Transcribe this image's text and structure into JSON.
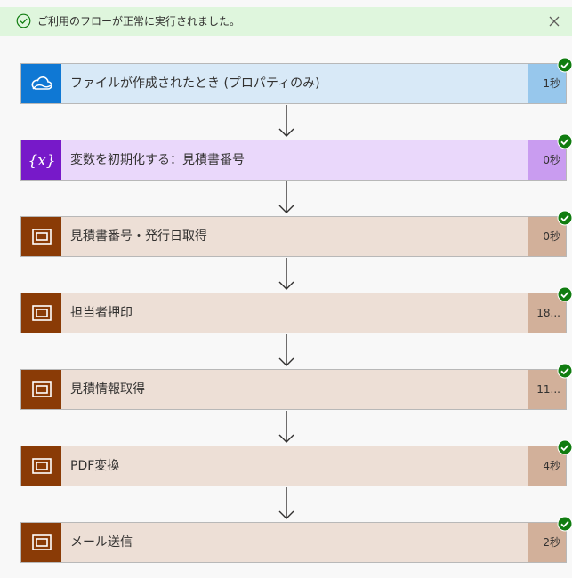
{
  "banner": {
    "message": "ご利用のフローが正常に実行されました。"
  },
  "colors": {
    "banner_bg": "#dff6dd",
    "success_green": "#107c10"
  },
  "steps": [
    {
      "title": "ファイルが作成されたとき (プロパティのみ)",
      "duration": "1秒",
      "icon": "onedrive-cloud-icon",
      "icon_bg": "#0f78d4",
      "body_bg": "#d8e9f7",
      "dur_bg": "#97c7ec",
      "status": "succeeded"
    },
    {
      "title": "変数を初期化する：見積書番号",
      "duration": "0秒",
      "icon": "variable-icon",
      "icon_bg": "#7719c9",
      "body_bg": "#ead8fb",
      "dur_bg": "#c99cf0",
      "status": "succeeded"
    },
    {
      "title": "見積書番号・発行日取得",
      "duration": "0秒",
      "icon": "scope-icon",
      "icon_bg": "#8a3b06",
      "body_bg": "#eddfd6",
      "dur_bg": "#d2b09a",
      "status": "succeeded"
    },
    {
      "title": "担当者押印",
      "duration": "18...",
      "icon": "scope-icon",
      "icon_bg": "#8a3b06",
      "body_bg": "#eddfd6",
      "dur_bg": "#d2b09a",
      "status": "succeeded"
    },
    {
      "title": "見積情報取得",
      "duration": "11...",
      "icon": "scope-icon",
      "icon_bg": "#8a3b06",
      "body_bg": "#eddfd6",
      "dur_bg": "#d2b09a",
      "status": "succeeded"
    },
    {
      "title": "PDF変換",
      "duration": "4秒",
      "icon": "scope-icon",
      "icon_bg": "#8a3b06",
      "body_bg": "#eddfd6",
      "dur_bg": "#d2b09a",
      "status": "succeeded"
    },
    {
      "title": "メール送信",
      "duration": "2秒",
      "icon": "scope-icon",
      "icon_bg": "#8a3b06",
      "body_bg": "#eddfd6",
      "dur_bg": "#d2b09a",
      "status": "succeeded"
    }
  ]
}
